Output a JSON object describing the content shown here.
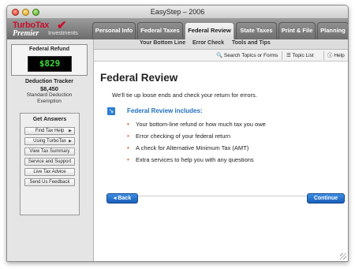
{
  "window": {
    "title": "EasyStep – 2006"
  },
  "logo": {
    "brand": "TurboTax",
    "edition": "Premier",
    "suffix": "Investments"
  },
  "tabs": [
    {
      "label": "Personal Info",
      "active": false
    },
    {
      "label": "Federal Taxes",
      "active": false
    },
    {
      "label": "Federal Review",
      "active": true
    },
    {
      "label": "State Taxes",
      "active": false
    },
    {
      "label": "Print & File",
      "active": false
    },
    {
      "label": "Planning",
      "active": false
    }
  ],
  "subnav": [
    "Your Bottom Line",
    "Error Check",
    "Tools and Tips"
  ],
  "toolbar": {
    "search": "Search Topics or Forms",
    "topic_list": "Topic List",
    "help": "Help"
  },
  "sidebar": {
    "refund_label": "Federal Refund",
    "refund_value": "$829",
    "deduction_title": "Deduction Tracker",
    "deduction_value": "$8,450",
    "deduction_note_1": "Standard Deduction",
    "deduction_note_2": "Exemption",
    "answers_title": "Get Answers",
    "answers": [
      {
        "label": "Find Tax Help",
        "arrow": true
      },
      {
        "label": "Using TurboTax",
        "arrow": true
      },
      {
        "label": "View Tax Summary",
        "arrow": false
      },
      {
        "label": "Service and Support",
        "arrow": false
      },
      {
        "label": "Live Tax Advice",
        "arrow": false
      },
      {
        "label": "Send Us Feedback",
        "arrow": false
      }
    ]
  },
  "main": {
    "title": "Federal Review",
    "intro": "We'll tie up loose ends and check your return for errors.",
    "includes_title": "Federal Review includes:",
    "bullets": [
      "Your bottom-line refund or how much tax you owe",
      "Error checking of your federal return",
      "A check for Alternative Minimum Tax (AMT)",
      "Extra services to help you with any questions"
    ],
    "back_label": "Back",
    "continue_label": "Continue"
  },
  "colors": {
    "accent": "#1f6fc0",
    "refund_digits": "#3edc3a",
    "bullet": "#d6562b",
    "brand_red": "#c8102e"
  }
}
